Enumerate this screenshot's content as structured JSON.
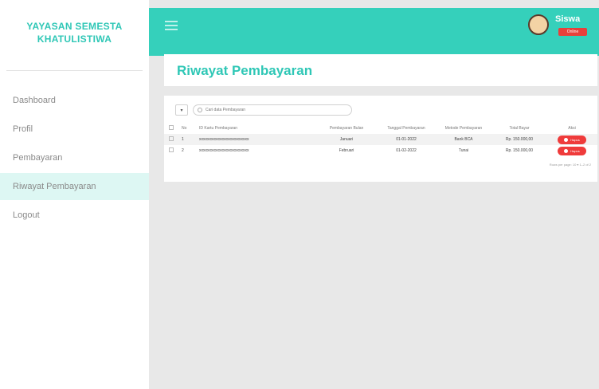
{
  "sidebar": {
    "brand_line1": "YAYASAN SEMESTA",
    "brand_line2": "KHATULISTIWA",
    "items": [
      {
        "label": "Dashboard",
        "active": false
      },
      {
        "label": "Profil",
        "active": false
      },
      {
        "label": "Pembayaran",
        "active": false
      },
      {
        "label": "Riwayat Pembayaran",
        "active": true
      },
      {
        "label": "Logout",
        "active": false
      }
    ]
  },
  "header": {
    "user_name": "Siswa",
    "user_badge": "Online",
    "icons": {
      "menu": "hamburger-icon",
      "avatar": "student-avatar"
    }
  },
  "page": {
    "title": "Riwayat Pembayaran"
  },
  "table": {
    "entries_value": "▾",
    "search_placeholder": "Cari data Pembayaran",
    "headers": [
      "No",
      "ID Kartu Pembayaran",
      "Pembayaran Bulan",
      "Tanggal Pembayaran",
      "Metode Pembayaran",
      "Total Bayar",
      "Aksi"
    ],
    "rows": [
      {
        "no": "1",
        "id": "xxxxxxxxxxxxxxxxxxxxxxxxx",
        "bulan": "Januari",
        "tanggal": "01-01-2022",
        "metode": "Bank BCA",
        "total": "Rp. 150.000,00",
        "aksi": "Hapus"
      },
      {
        "no": "2",
        "id": "xxxxxxxxxxxxxxxxxxxxxxxxx",
        "bulan": "Februari",
        "tanggal": "01-02-2022",
        "metode": "Tunai",
        "total": "Rp. 150.000,00",
        "aksi": "Hapus"
      }
    ],
    "pager_text": "Rows per page: 10 ▾   1–2 of 2"
  },
  "colors": {
    "accent": "#35d0bb",
    "brand_text": "#2fc7b6",
    "danger": "#ef3b3b",
    "active_menu_bg": "#ddf7f3"
  }
}
